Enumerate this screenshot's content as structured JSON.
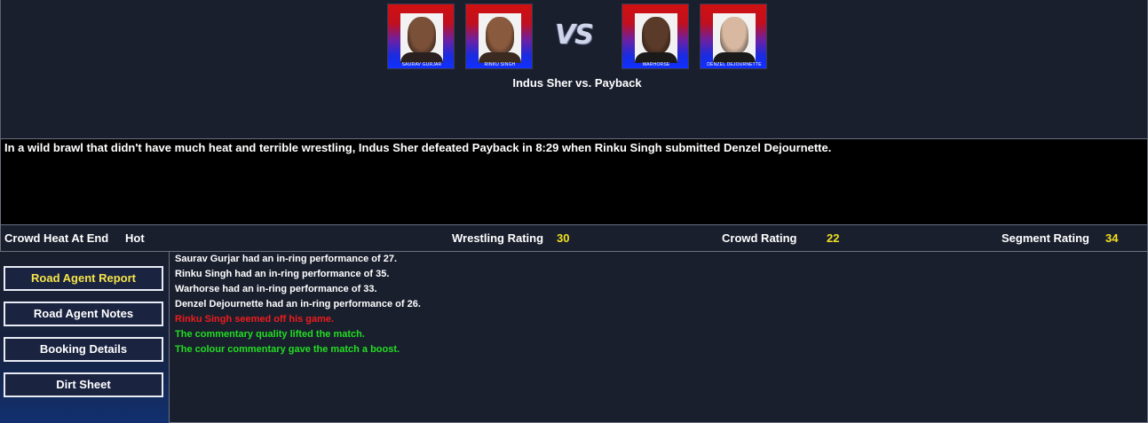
{
  "match": {
    "title": "Indus Sher vs. Payback",
    "vs_label": "VS",
    "portraits": [
      {
        "caption": "SAURAV GURJAR",
        "skin": "#7a5038",
        "hair": "#1a1210",
        "shirt": "#2a2020"
      },
      {
        "caption": "RINKU SINGH",
        "skin": "#8a5a3e",
        "hair": "#1a1210",
        "shirt": "#3a2a20"
      },
      {
        "caption": "WARHORSE",
        "skin": "#5a3a28",
        "hair": "#1a1410",
        "shirt": "#1a1a1a"
      },
      {
        "caption": "DENZEL DEJOURNETTE",
        "skin": "#d8b8a0",
        "hair": "#2a2a2a",
        "shirt": "#1a1a1a"
      }
    ]
  },
  "summary": "In a wild brawl that didn't have much heat and terrible wrestling, Indus Sher defeated Payback in 8:29 when Rinku Singh submitted Denzel Dejournette.",
  "ratings": {
    "crowd_heat_label": "Crowd Heat At End",
    "crowd_heat_value": "Hot",
    "wrestling_label": "Wrestling Rating",
    "wrestling_value": "30",
    "crowd_label": "Crowd Rating",
    "crowd_value": "22",
    "segment_label": "Segment Rating",
    "segment_value": "34"
  },
  "nav": {
    "road_agent_report": "Road Agent Report",
    "road_agent_notes": "Road Agent Notes",
    "booking_details": "Booking Details",
    "dirt_sheet": "Dirt Sheet"
  },
  "log": [
    {
      "text": "Saurav Gurjar had an in-ring performance of 27.",
      "color": "#ffffff"
    },
    {
      "text": "Rinku Singh had an in-ring performance of 35.",
      "color": "#ffffff"
    },
    {
      "text": "Warhorse had an in-ring performance of 33.",
      "color": "#ffffff"
    },
    {
      "text": "Denzel Dejournette had an in-ring performance of 26.",
      "color": "#ffffff"
    },
    {
      "text": "Rinku Singh seemed off his game.",
      "color": "#ee1c1c"
    },
    {
      "text": "The commentary quality lifted the match.",
      "color": "#22dd22"
    },
    {
      "text": "The colour commentary gave the match a boost.",
      "color": "#22dd22"
    }
  ],
  "colors": {
    "background": "#1a1f2e",
    "highlight_value": "#f0e020",
    "active_nav": "#f5e44a"
  }
}
